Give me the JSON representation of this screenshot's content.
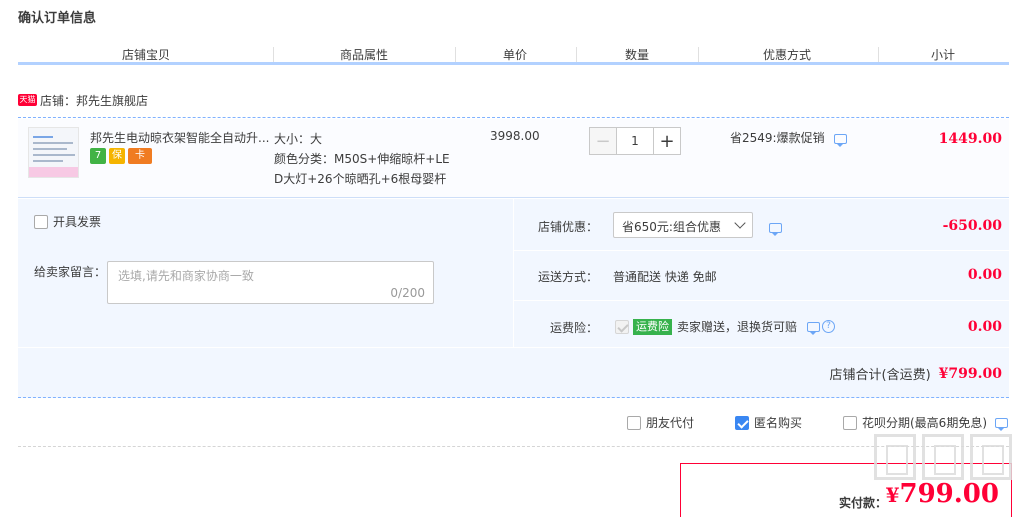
{
  "page_title": "确认订单信息",
  "columns": [
    "店铺宝贝",
    "商品属性",
    "单价",
    "数量",
    "优惠方式",
    "小计"
  ],
  "shop": {
    "badge": "天猫",
    "label": "店铺：邦先生旗舰店"
  },
  "item": {
    "name": "邦先生电动晾衣架智能全自动升...",
    "badges": [
      "7",
      "保",
      "卡"
    ],
    "attr_size": "大小：大",
    "attr_color_1": "颜色分类：M50S+伸缩晾杆+LE",
    "attr_color_2": "D大灯+26个晾晒孔+6根母婴杆",
    "unit_price": "3998.00",
    "quantity": "1",
    "minus": "−",
    "plus": "+",
    "promo": "省2549:爆款促销",
    "subtotal": "1449.00"
  },
  "invoice": {
    "label": "开具发票",
    "checked": false
  },
  "memo": {
    "label": "给卖家留言：",
    "placeholder": "选填,请先和商家协商一致",
    "counter": "0/200"
  },
  "shop_discount": {
    "label": "店铺优惠：",
    "selected": "省650元:组合优惠",
    "amount": "-650.00"
  },
  "shipping": {
    "label": "运送方式：",
    "value": "普通配送 快递 免邮",
    "amount": "0.00"
  },
  "insurance": {
    "label": "运费险：",
    "tag": "运费险",
    "desc": "卖家赠送，退换货可赔",
    "help": "?",
    "amount": "0.00"
  },
  "shop_total": {
    "label": "店铺合计(含运费)",
    "amount": "¥799.00"
  },
  "options": [
    {
      "label": "朋友代付",
      "checked": false
    },
    {
      "label": "匿名购买",
      "checked": true
    },
    {
      "label": "花呗分期(最高6期免息)",
      "checked": false
    }
  ],
  "pay": {
    "label": "实付款：",
    "currency": "¥",
    "amount": "799.00"
  },
  "colors": {
    "accent": "#ff0036",
    "blue": "#3a87f2",
    "header_line": "#b2d1ff",
    "panel_bg": "#f2f7ff"
  }
}
